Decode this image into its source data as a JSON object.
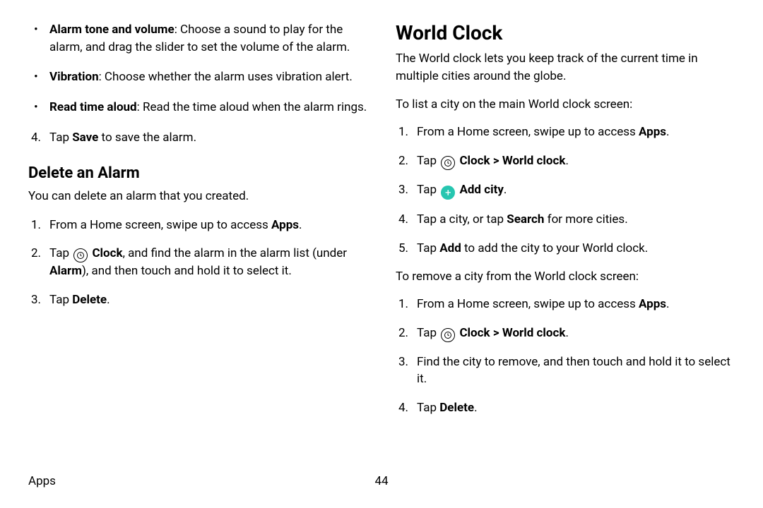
{
  "left": {
    "bullets": [
      {
        "label": "Alarm tone and volume",
        "text": ": Choose a sound to play for the alarm, and drag the slider to set the volume of the alarm."
      },
      {
        "label": "Vibration",
        "text": ": Choose whether the alarm uses vibration alert."
      },
      {
        "label": "Read time aloud",
        "text": ": Read the time aloud when the alarm rings."
      }
    ],
    "step4_num": "4.",
    "step4_a": "Tap ",
    "step4_b": "Save",
    "step4_c": " to save the alarm.",
    "delete_head": "Delete an Alarm",
    "delete_intro": "You can delete an alarm that you created.",
    "del_steps": {
      "s1_num": "1.",
      "s1_a": "From a Home screen, swipe up to access ",
      "s1_b": "Apps",
      "s1_c": ".",
      "s2_num": "2.",
      "s2_a": "Tap ",
      "s2_b": "Clock",
      "s2_c": ", and find the alarm in the alarm list (under ",
      "s2_d": "Alarm",
      "s2_e": "), and then touch and hold it to select it.",
      "s3_num": "3.",
      "s3_a": "Tap ",
      "s3_b": "Delete",
      "s3_c": "."
    }
  },
  "right": {
    "head": "World Clock",
    "intro": "The World clock lets you keep track of the current time in multiple cities around the globe.",
    "lead1": "To list a city on the main World clock screen:",
    "add": {
      "s1_num": "1.",
      "s1_a": "From a Home screen, swipe up to access ",
      "s1_b": "Apps",
      "s1_c": ".",
      "s2_num": "2.",
      "s2_a": "Tap ",
      "s2_b": "Clock",
      "s2_chev": " > ",
      "s2_c": "World clock",
      "s2_d": ".",
      "s3_num": "3.",
      "s3_a": "Tap ",
      "s3_b": "Add city",
      "s3_c": ".",
      "s4_num": "4.",
      "s4_a": "Tap a city, or tap ",
      "s4_b": "Search",
      "s4_c": " for more cities.",
      "s5_num": "5.",
      "s5_a": "Tap ",
      "s5_b": "Add",
      "s5_c": " to add the city to your World clock."
    },
    "lead2": "To remove a city from the World clock screen:",
    "rem": {
      "s1_num": "1.",
      "s1_a": "From a Home screen, swipe up to access ",
      "s1_b": "Apps",
      "s1_c": ".",
      "s2_num": "2.",
      "s2_a": "Tap ",
      "s2_b": "Clock",
      "s2_chev": " > ",
      "s2_c": "World clock",
      "s2_d": ".",
      "s3_num": "3.",
      "s3_text": "Find the city to remove, and then touch and hold it to select it.",
      "s4_num": "4.",
      "s4_a": "Tap ",
      "s4_b": "Delete",
      "s4_c": "."
    }
  },
  "footer": {
    "section": "Apps",
    "page": "44"
  },
  "icons": {
    "plus": "+"
  }
}
